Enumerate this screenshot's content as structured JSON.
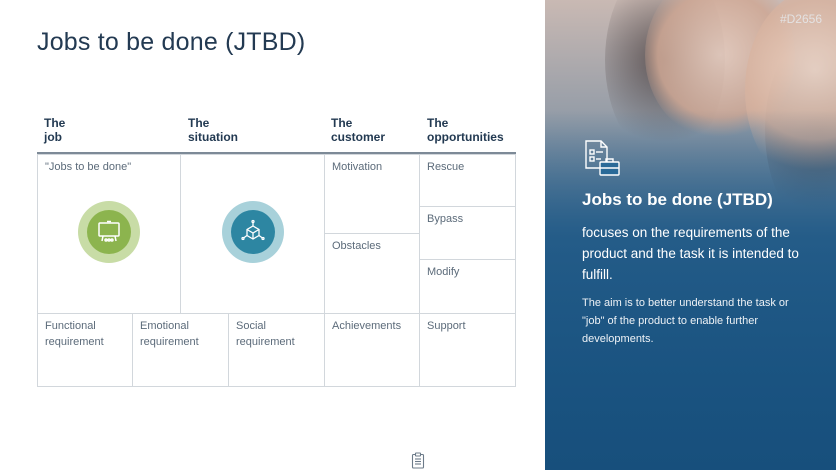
{
  "slide": {
    "title": "Jobs to be done (JTBD)",
    "code": "#D2656"
  },
  "columns": [
    {
      "line1": "The",
      "line2": "job"
    },
    {
      "line1": "The",
      "line2": "situation"
    },
    {
      "line1": "The",
      "line2": "customer"
    },
    {
      "line1": "The",
      "line2": "opportunities"
    }
  ],
  "cells": {
    "jobs_to_be_done": "\"Jobs to be done\"",
    "motivation": "Motivation",
    "obstacles": "Obstacles",
    "achievements": "Achievements",
    "rescue": "Rescue",
    "bypass": "Bypass",
    "modify": "Modify",
    "support": "Support",
    "functional": "Functional requirement",
    "emotional": "Emotional requirement",
    "social": "Social requirement"
  },
  "icons": {
    "job": "presentation-board-icon",
    "situation": "cube-network-icon",
    "panel": "document-briefcase-icon",
    "footer": "clipboard-icon"
  },
  "colors": {
    "green_outer": "#c8dca6",
    "green_inner": "#8cb44e",
    "teal_outer": "#a8d1da",
    "teal_inner": "#2d86a2",
    "title": "#233a52"
  },
  "panel": {
    "title": "Jobs to be done (JTBD)",
    "lead": "focuses on the requirements of the product and the task it is intended to fulfill.",
    "body": "The aim is to better understand the task or \"job\" of the product to enable further developments."
  }
}
